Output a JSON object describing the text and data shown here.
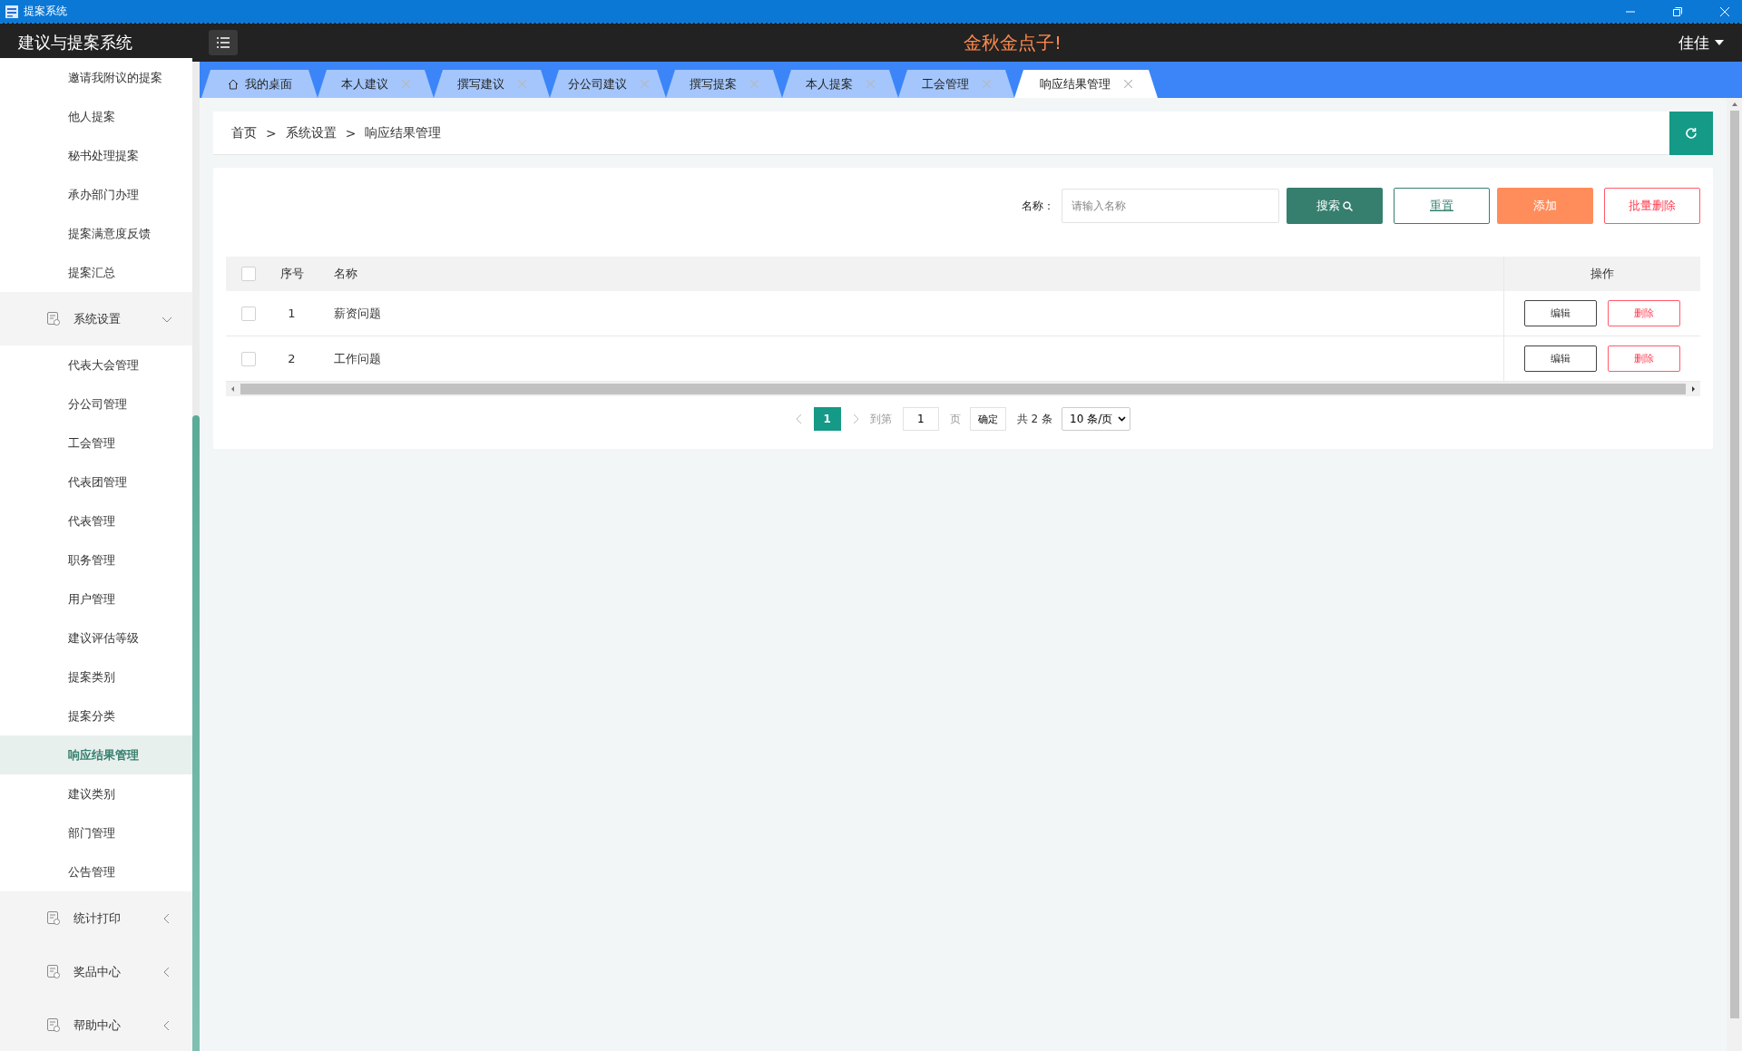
{
  "window": {
    "title": "提案系统"
  },
  "header": {
    "app_name": "建议与提案系统",
    "slogan": "金秋金点子!",
    "user": "佳佳"
  },
  "sidebar": {
    "items": [
      {
        "kind": "item",
        "label": "邀请我附议的提案",
        "selected": false
      },
      {
        "kind": "item",
        "label": "他人提案",
        "selected": false
      },
      {
        "kind": "item",
        "label": "秘书处理提案",
        "selected": false
      },
      {
        "kind": "item",
        "label": "承办部门办理",
        "selected": false
      },
      {
        "kind": "item",
        "label": "提案满意度反馈",
        "selected": false
      },
      {
        "kind": "item",
        "label": "提案汇总",
        "selected": false
      },
      {
        "kind": "group",
        "label": "系统设置",
        "selected": false,
        "expanded": true,
        "children": [
          {
            "label": "代表大会管理",
            "selected": false
          },
          {
            "label": "分公司管理",
            "selected": false
          },
          {
            "label": "工会管理",
            "selected": false
          },
          {
            "label": "代表团管理",
            "selected": false
          },
          {
            "label": "代表管理",
            "selected": false
          },
          {
            "label": "职务管理",
            "selected": false
          },
          {
            "label": "用户管理",
            "selected": false
          },
          {
            "label": "建议评估等级",
            "selected": false
          },
          {
            "label": "提案类别",
            "selected": false
          },
          {
            "label": "提案分类",
            "selected": false
          },
          {
            "label": "响应结果管理",
            "selected": true
          },
          {
            "label": "建议类别",
            "selected": false
          },
          {
            "label": "部门管理",
            "selected": false
          },
          {
            "label": "公告管理",
            "selected": false
          }
        ]
      },
      {
        "kind": "group",
        "label": "统计打印",
        "selected": false,
        "expanded": false
      },
      {
        "kind": "group",
        "label": "奖品中心",
        "selected": false,
        "expanded": false
      },
      {
        "kind": "group",
        "label": "帮助中心",
        "selected": false,
        "expanded": false
      }
    ]
  },
  "tabs": [
    {
      "kind": "home",
      "label": "我的桌面",
      "selected": false
    },
    {
      "kind": "page",
      "label": "本人建议",
      "selected": false
    },
    {
      "kind": "page",
      "label": "撰写建议",
      "selected": false
    },
    {
      "kind": "page",
      "label": "分公司建议",
      "selected": false
    },
    {
      "kind": "page",
      "label": "撰写提案",
      "selected": false
    },
    {
      "kind": "page",
      "label": "本人提案",
      "selected": false
    },
    {
      "kind": "page",
      "label": "工会管理",
      "selected": false
    },
    {
      "kind": "page",
      "label": "响应结果管理",
      "selected": true
    }
  ],
  "breadcrumb": {
    "items": [
      "首页",
      "系统设置",
      "响应结果管理"
    ],
    "separator": ">"
  },
  "toolbar": {
    "label": "名称：",
    "placeholder": "请输入名称",
    "buttons": [
      {
        "kind": "search",
        "label": "搜索"
      },
      {
        "kind": "reset",
        "label": "重置"
      },
      {
        "kind": "add",
        "label": "添加"
      },
      {
        "kind": "danger",
        "label": "批量删除"
      }
    ]
  },
  "table": {
    "columns": [
      "序号",
      "名称",
      "操作"
    ],
    "all_checked": false,
    "rows": [
      {
        "checked": false,
        "index": "1",
        "name": "薪资问题",
        "actions": [
          "编辑",
          "删除"
        ]
      },
      {
        "checked": false,
        "index": "2",
        "name": "工作问题",
        "actions": [
          "编辑",
          "删除"
        ]
      }
    ]
  },
  "pagination": {
    "pages": [
      {
        "label": "1",
        "selected": true
      }
    ],
    "goto_label": "到第",
    "page_input": "1",
    "page_unit": "页",
    "confirm": "确定",
    "total": "共 2 条",
    "page_size": "10 条/页"
  }
}
